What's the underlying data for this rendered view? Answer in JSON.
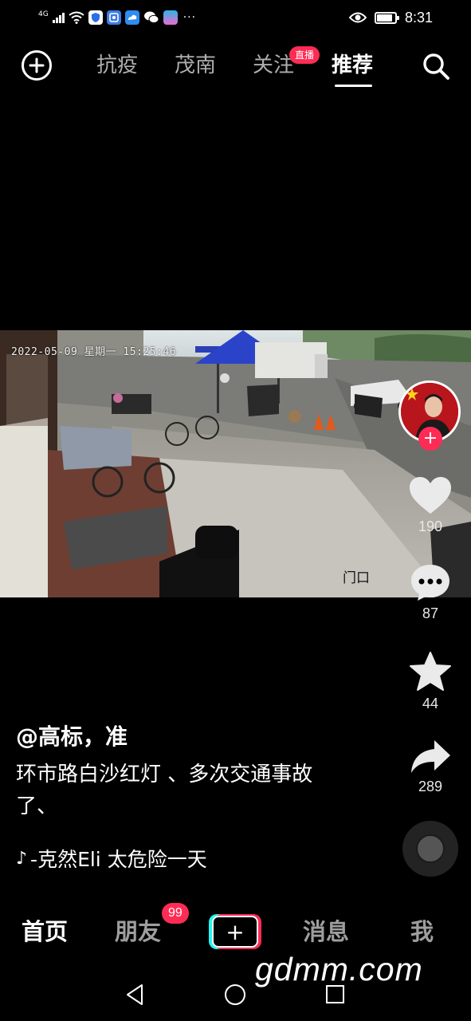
{
  "status_bar": {
    "network": "4G",
    "time": "8:31",
    "battery_level": 0.85,
    "icons": [
      "signal-icon",
      "wifi-icon",
      "shield-app-icon",
      "music-app-icon",
      "cloud-app-icon",
      "wechat-icon",
      "game-app-icon",
      "more-dots-icon",
      "eye-icon",
      "battery-icon"
    ],
    "more": "···"
  },
  "top_nav": {
    "tabs": [
      {
        "label": "抗疫",
        "active": false
      },
      {
        "label": "茂南",
        "active": false
      },
      {
        "label": "关注",
        "active": false,
        "badge": "直播"
      },
      {
        "label": "推荐",
        "active": true
      }
    ]
  },
  "video": {
    "timestamp": "2022-05-09 星期一 15:25:46",
    "location_label": "门口"
  },
  "actions": {
    "likes": "190",
    "comments": "87",
    "favorites": "44",
    "shares": "289",
    "follow_symbol": "+"
  },
  "post": {
    "author": "@高标，准",
    "caption": "环市路白沙红灯 、多次交通事故了、",
    "music": "-克然Eli    太危险一天"
  },
  "bottom_nav": {
    "items": [
      {
        "label": "首页",
        "active": true
      },
      {
        "label": "朋友",
        "active": false,
        "badge": "99"
      },
      {
        "label": "消息",
        "active": false
      },
      {
        "label": "我",
        "active": false
      }
    ],
    "create_symbol": "+"
  },
  "watermark": "gdmm.com",
  "colors": {
    "accent": "#fe2c55",
    "cyan": "#25f4ee",
    "background": "#000000"
  }
}
